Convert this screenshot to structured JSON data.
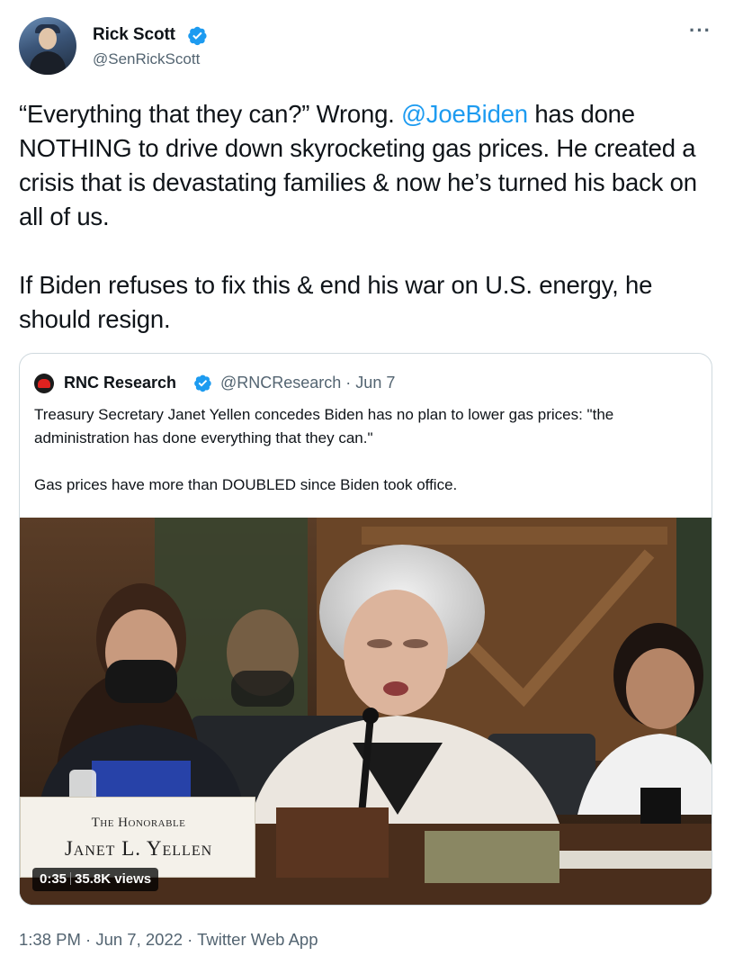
{
  "author": {
    "name": "Rick Scott",
    "handle": "@SenRickScott",
    "verified": true,
    "avatar_icon": "profile-photo"
  },
  "more_icon": "ellipsis-icon",
  "more_label": "···",
  "body": {
    "p1_before": "“Everything that they can?” Wrong. ",
    "p1_mention": "@JoeBiden",
    "p1_after": " has done NOTHING to drive down skyrocketing gas prices. He created a crisis that is devastating families & now he’s turned his back on all of us.",
    "p2": "If Biden refuses to fix this & end his war on U.S. energy, he should resign."
  },
  "quoted": {
    "name": "RNC Research",
    "verified": true,
    "handle_date": "@RNCResearch · Jun 7",
    "text_p1": "Treasury Secretary Janet Yellen concedes Biden has no plan to lower gas prices: \"the administration has done everything that they can.\"",
    "text_p2": "Gas prices have more than DOUBLED since Biden took office.",
    "video": {
      "placard_line1": "The Honorable",
      "placard_line2": "Janet L. Yellen",
      "duration": "0:35",
      "views": "35.8K views"
    }
  },
  "footer": {
    "meta": "1:38 PM · Jun 7, 2022 · Twitter Web App"
  },
  "colors": {
    "link": "#1d9bf0",
    "secondary_text": "#536471",
    "border": "#cfd9de"
  }
}
